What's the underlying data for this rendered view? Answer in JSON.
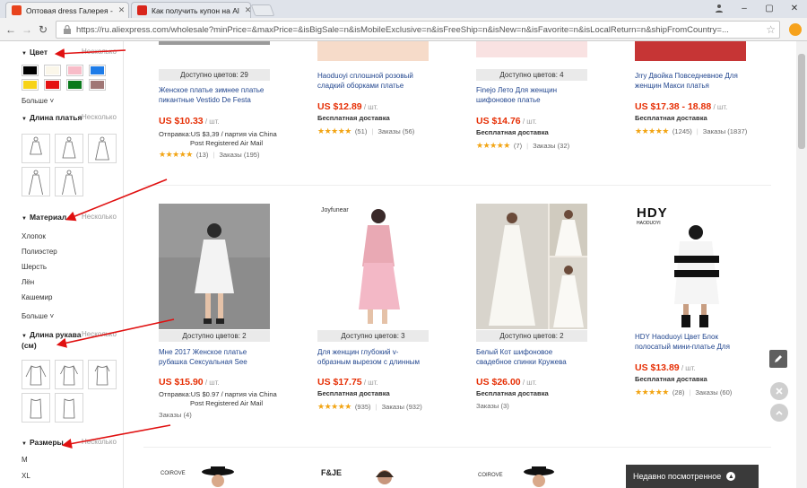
{
  "browser": {
    "tabs": [
      {
        "title": "Оптовая dress Галерея - "
      },
      {
        "title": "Как получить купон на Al"
      }
    ],
    "url": "https://ru.aliexpress.com/wholesale?minPrice=&maxPrice=&isBigSale=n&isMobileExclusive=n&isFreeShip=n&isNew=n&isFavorite=n&isLocalReturn=n&shipFromCountry=..."
  },
  "filters": {
    "multi_label": "Несколько",
    "more_label": "Больше",
    "color": {
      "title": "Цвет",
      "swatches": [
        "#000000",
        "#fbf7ea",
        "#f8bcc8",
        "#1e7ce8",
        "#f7d318",
        "#e51212",
        "#0a7a1c",
        "#a07675"
      ]
    },
    "dress_length": {
      "title": "Длина платья",
      "shapes": [
        "short-dress-icon",
        "midi-dress-icon",
        "knee-dress-icon",
        "long-dress-icon",
        "maxi-dress-icon"
      ]
    },
    "material": {
      "title": "Материал",
      "items": [
        "Хлопок",
        "Полиэстер",
        "Шерсть",
        "Лён",
        "Кашемир"
      ]
    },
    "sleeve": {
      "title": "Длина рукава (см)",
      "shapes": [
        "long-sleeve-icon",
        "three-quarter-sleeve-icon",
        "half-sleeve-icon",
        "sleeveless-icon",
        "strap-icon"
      ]
    },
    "sizes": {
      "title": "Размеры",
      "items": [
        "M",
        "XL"
      ]
    }
  },
  "products_row1": [
    {
      "avail": "Доступно цветов: 29",
      "title": [
        "Женское платье зимнее платье",
        "пикантные Vestido De Festa"
      ],
      "price": "US $10.33",
      "unit": " / шт.",
      "ship_lines": [
        "Отправка:US $3,39 / партия via China",
        "Post Registered Air Mail"
      ],
      "rating": "(13)",
      "orders": "Заказы (195)",
      "colors": [
        "#9a9a9a",
        "#b8b8b8"
      ]
    },
    {
      "avail": "",
      "title": [
        "Haoduoyi сплошной розовый",
        "сладкий оборками платье"
      ],
      "price": "US $12.89",
      "unit": " / шт.",
      "ship": "Бесплатная доставка",
      "rating": "(51)",
      "orders": "Заказы (56)",
      "colors": [
        "#f1c9b3",
        "#ffffff"
      ]
    },
    {
      "avail": "Доступно цветов: 4",
      "title": [
        "Finejo Лето Для женщин",
        "шифоновое платье"
      ],
      "price": "US $14.76",
      "unit": " / шт.",
      "ship": "Бесплатная доставка",
      "rating": "(7)",
      "orders": "Заказы (32)",
      "colors": [
        "#f6d7d7",
        "#ffffff"
      ]
    },
    {
      "avail": "",
      "title": [
        "Jrry Двойка Повседневное Для",
        "женщин Макси платья"
      ],
      "price": "US $17.38 - 18.88",
      "unit": " / шт.",
      "ship": "Бесплатная доставка",
      "rating": "(1245)",
      "orders": "Заказы (1837)",
      "colors": [
        "#c32a2a",
        "#ffffff"
      ]
    }
  ],
  "products_row2": [
    {
      "avail": "Доступно цветов: 2",
      "title": [
        "Мне 2017 Женское платье",
        "рубашка Сексуальная See"
      ],
      "price": "US $15.90",
      "unit": " / шт.",
      "ship_lines": [
        "Отправка:US $0.97 / партия via China",
        "Post Registered Air Mail"
      ],
      "rating": "",
      "orders": "Заказы (4)"
    },
    {
      "avail": "Доступно цветов: 3",
      "brand": "Joyfunear",
      "title": [
        "Для женщин глубокий v-",
        "образным вырезом с длинным"
      ],
      "price": "US $17.75",
      "unit": " / шт.",
      "ship": "Бесплатная доставка",
      "rating": "(935)",
      "orders": "Заказы (932)"
    },
    {
      "avail": "Доступно цветов: 2",
      "title": [
        "Белый Кот шифоновое",
        "свадебное спинки Кружева"
      ],
      "price": "US $26.00",
      "unit": " / шт.",
      "ship": "Бесплатная доставка",
      "rating": "",
      "orders": "Заказы (3)"
    },
    {
      "avail": "",
      "brand": "HDY",
      "brand_sub": "HAODUOYI",
      "title": [
        "HDY Haoduoyi Цвет Блок",
        "полосатый мини-платье Для"
      ],
      "price": "US $13.89",
      "unit": " / шт.",
      "ship": "Бесплатная доставка",
      "rating": "(28)",
      "orders": "Заказы (60)"
    }
  ],
  "products_row3": [
    {
      "brand": "COIROVE"
    },
    {
      "brand": "F&JE"
    },
    {
      "brand": "COIROVE"
    },
    {
      "brand": ""
    }
  ],
  "recently_viewed": "Недавно посмотренное"
}
